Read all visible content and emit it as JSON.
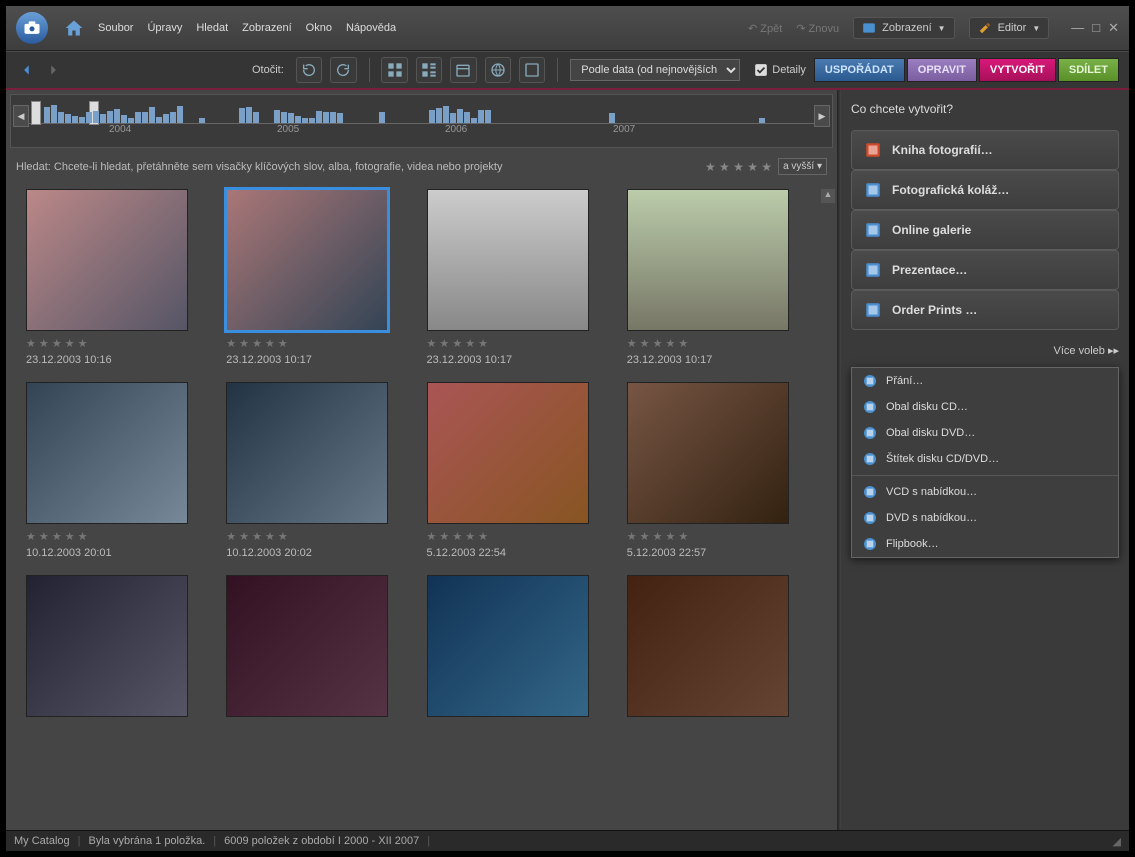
{
  "menubar": {
    "items": [
      "Soubor",
      "Úpravy",
      "Hledat",
      "Zobrazení",
      "Okno",
      "Nápověda"
    ],
    "undo": "Zpět",
    "redo": "Znovu",
    "view": "Zobrazení",
    "editor": "Editor"
  },
  "toolbar": {
    "rotate_label": "Otočit:",
    "sort_select": "Podle data (od nejnovějších)",
    "details": "Detaily",
    "tabs": {
      "organize": "USPOŘÁDAT",
      "fix": "OPRAVIT",
      "create": "VYTVOŘIT",
      "share": "SDÍLET"
    }
  },
  "timeline": {
    "years": [
      "2004",
      "2005",
      "2006",
      "2007"
    ]
  },
  "search": {
    "hint": "Hledat: Chcete-li hledat, přetáhněte sem visačky klíčových slov, alba, fotografie, videa nebo projekty",
    "rating_sel": "a vyšší"
  },
  "thumbs": [
    {
      "date": "23.12.2003 10:16",
      "selected": false,
      "bg": "linear-gradient(135deg,#b88,#556)"
    },
    {
      "date": "23.12.2003 10:17",
      "selected": true,
      "bg": "linear-gradient(135deg,#a77,#345)"
    },
    {
      "date": "23.12.2003 10:17",
      "selected": false,
      "bg": "linear-gradient(180deg,#ccc,#888)"
    },
    {
      "date": "23.12.2003 10:17",
      "selected": false,
      "bg": "linear-gradient(180deg,#bca,#776)"
    },
    {
      "date": "10.12.2003 20:01",
      "selected": false,
      "bg": "linear-gradient(135deg,#345,#789)"
    },
    {
      "date": "10.12.2003 20:02",
      "selected": false,
      "bg": "linear-gradient(135deg,#234,#678)"
    },
    {
      "date": "5.12.2003 22:54",
      "selected": false,
      "bg": "linear-gradient(135deg,#a55,#852)"
    },
    {
      "date": "5.12.2003 22:57",
      "selected": false,
      "bg": "linear-gradient(135deg,#754,#321)"
    },
    {
      "date": "",
      "selected": false,
      "bg": "linear-gradient(135deg,#223,#556)"
    },
    {
      "date": "",
      "selected": false,
      "bg": "linear-gradient(135deg,#312,#534)"
    },
    {
      "date": "",
      "selected": false,
      "bg": "linear-gradient(135deg,#135,#368)"
    },
    {
      "date": "",
      "selected": false,
      "bg": "linear-gradient(135deg,#421,#643)"
    }
  ],
  "panel": {
    "title": "Co chcete vytvořit?",
    "buttons": [
      {
        "label": "Kniha fotografií…",
        "icon": "book",
        "color": "#d04a2a"
      },
      {
        "label": "Fotografická koláž…",
        "icon": "collage",
        "color": "#4a90d0"
      },
      {
        "label": "Online galerie",
        "icon": "gallery",
        "color": "#4a90d0"
      },
      {
        "label": "Prezentace…",
        "icon": "slideshow",
        "color": "#4a90d0"
      },
      {
        "label": "Order Prints …",
        "icon": "prints",
        "color": "#4a90d0"
      }
    ],
    "more": "Více voleb",
    "popup": [
      {
        "label": "Přání…",
        "icon": "card"
      },
      {
        "label": "Obal disku CD…",
        "icon": "cd"
      },
      {
        "label": "Obal disku DVD…",
        "icon": "dvd"
      },
      {
        "label": "Štítek disku CD/DVD…",
        "icon": "label"
      },
      null,
      {
        "label": "VCD s nabídkou…",
        "icon": "vcd"
      },
      {
        "label": "DVD s nabídkou…",
        "icon": "dvdm"
      },
      {
        "label": "Flipbook…",
        "icon": "flip"
      }
    ]
  },
  "status": {
    "catalog": "My Catalog",
    "selection": "Byla vybrána 1 položka.",
    "count": "6009 položek z období I 2000 - XII 2007"
  }
}
